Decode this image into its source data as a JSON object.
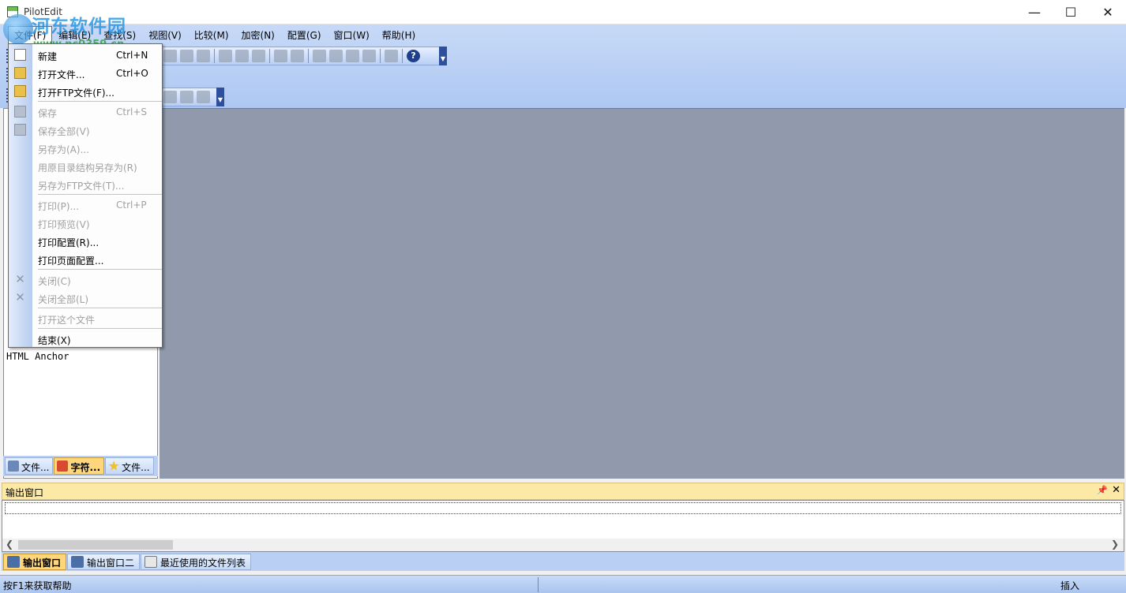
{
  "window": {
    "title": "PilotEdit",
    "min_glyph": "—",
    "max_glyph": "☐",
    "close_glyph": "✕"
  },
  "watermark": {
    "site_name": "河东软件园",
    "url": "www.pc0359.cn"
  },
  "menubar": [
    {
      "label": "文件(F)"
    },
    {
      "label": "编辑(E)"
    },
    {
      "label": "查找(S)"
    },
    {
      "label": "视图(V)"
    },
    {
      "label": "比较(M)"
    },
    {
      "label": "加密(N)"
    },
    {
      "label": "配置(G)"
    },
    {
      "label": "窗口(W)"
    },
    {
      "label": "帮助(H)"
    }
  ],
  "file_menu": {
    "new": {
      "label": "新建",
      "shortcut": "Ctrl+N"
    },
    "open": {
      "label": "打开文件...",
      "shortcut": "Ctrl+O"
    },
    "open_ftp": {
      "label": "打开FTP文件(F)..."
    },
    "save": {
      "label": "保存",
      "shortcut": "Ctrl+S"
    },
    "save_all": {
      "label": "保存全部(V)"
    },
    "save_as": {
      "label": "另存为(A)..."
    },
    "save_as_dir": {
      "label": "用原目录结构另存为(R)"
    },
    "save_as_ftp": {
      "label": "另存为FTP文件(T)..."
    },
    "print": {
      "label": "打印(P)...",
      "shortcut": "Ctrl+P"
    },
    "print_preview": {
      "label": "打印预览(V)"
    },
    "print_config": {
      "label": "打印配置(R)..."
    },
    "page_config": {
      "label": "打印页面配置..."
    },
    "close": {
      "label": "关闭(C)"
    },
    "close_all": {
      "label": "关闭全部(L)"
    },
    "open_this": {
      "label": "打开这个文件"
    },
    "exit": {
      "label": "结束(X)"
    }
  },
  "left_panel": {
    "anchor_text": "HTML Anchor",
    "tabs": [
      {
        "label": "文件..."
      },
      {
        "label": "字符..."
      },
      {
        "label": "文件..."
      }
    ]
  },
  "output": {
    "title": "输出窗口",
    "pin_glyph": "📌",
    "close_glyph": "✕",
    "tabs": [
      {
        "label": "输出窗口"
      },
      {
        "label": "输出窗口二"
      },
      {
        "label": "最近使用的文件列表"
      }
    ]
  },
  "toolbar": {
    "help_glyph": "?"
  },
  "status": {
    "help_text": "按F1来获取帮助",
    "mode": "插入"
  }
}
